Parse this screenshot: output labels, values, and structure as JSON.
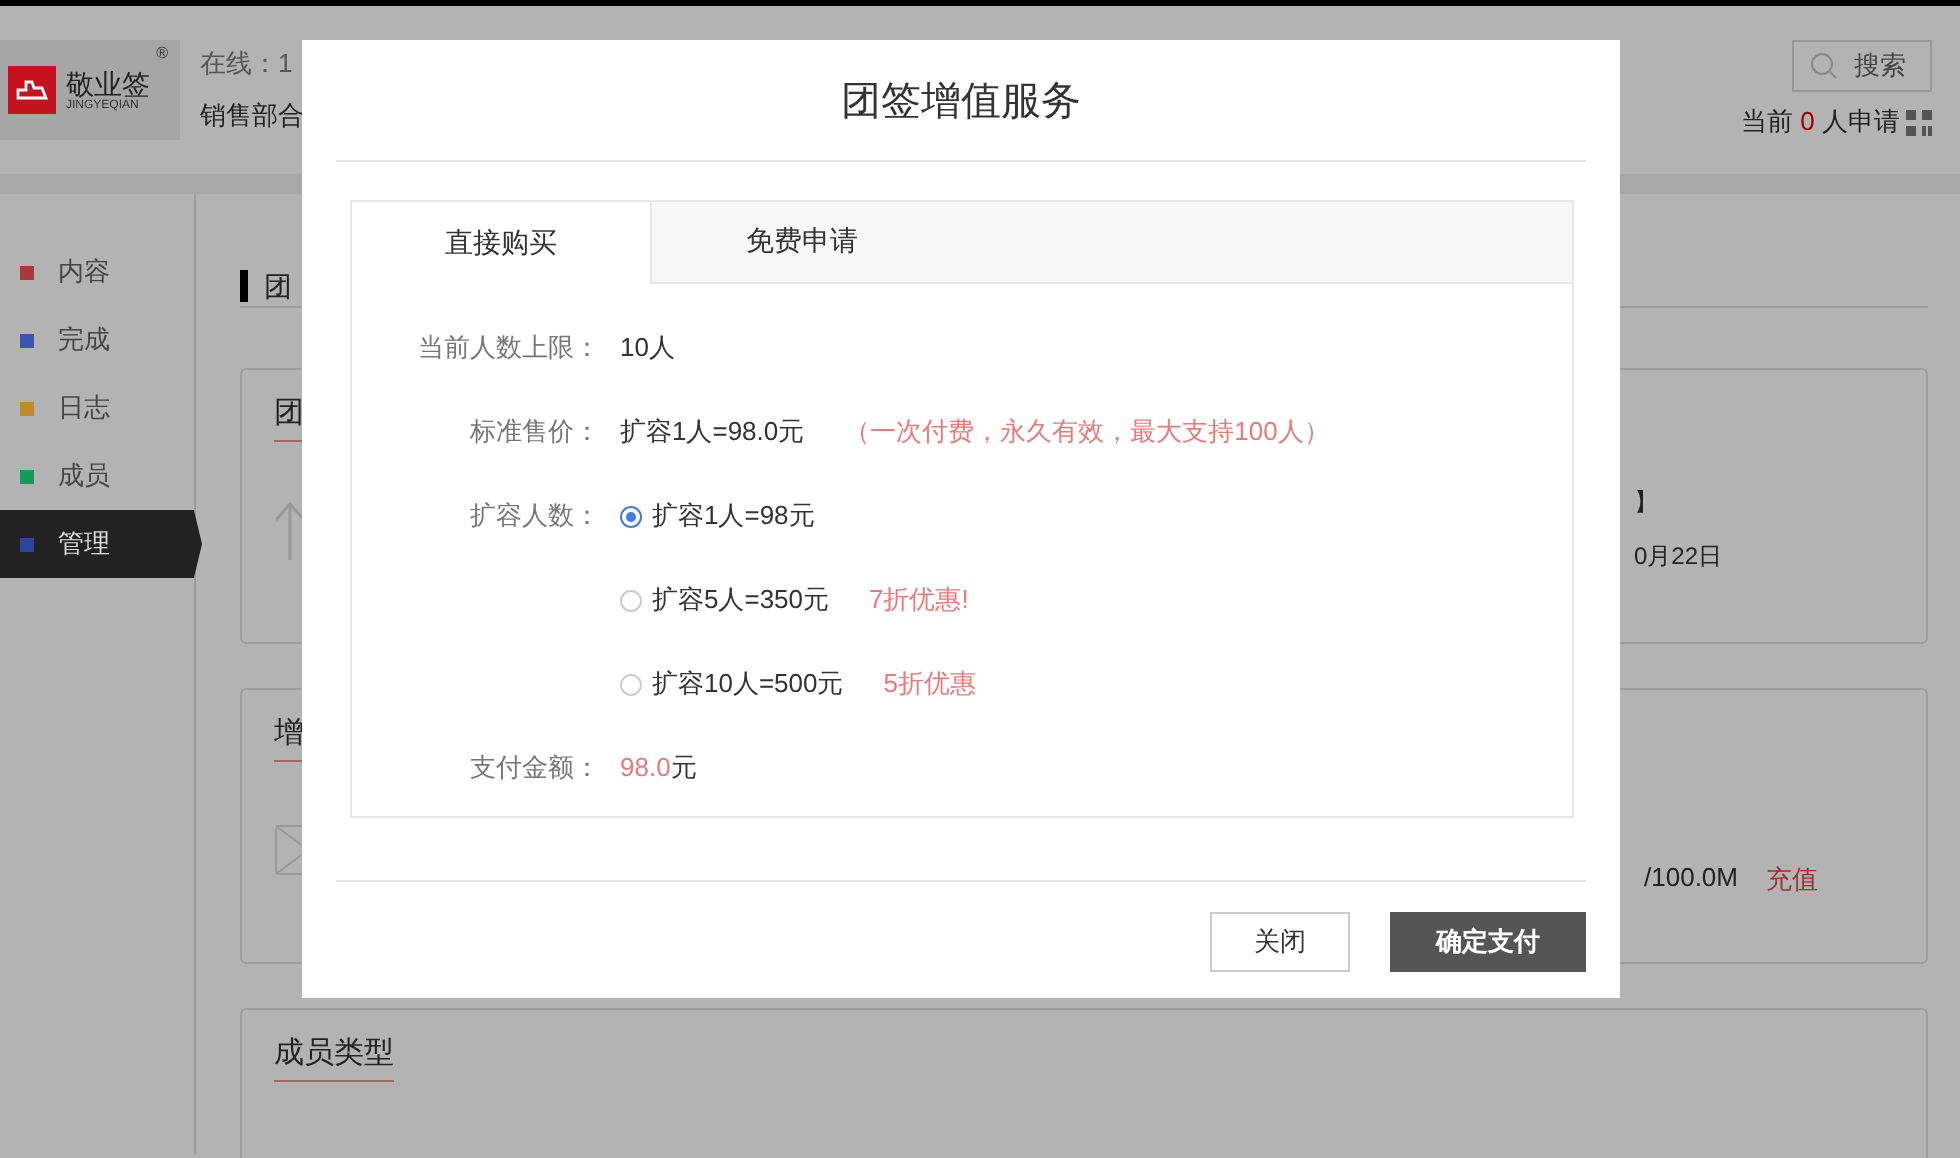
{
  "header": {
    "logo": {
      "name": "敬业签",
      "subtitle": "JINGYEQIAN",
      "mark": "®"
    },
    "online": "在线：1",
    "department": "销售部合",
    "search": {
      "placeholder": "搜索"
    },
    "applications": {
      "prefix": "当前",
      "count": "0",
      "suffix": "人申请"
    }
  },
  "sidebar": {
    "items": [
      {
        "label": "内容",
        "color": "#a83a3e",
        "selected": false
      },
      {
        "label": "完成",
        "color": "#3b55b0",
        "selected": false
      },
      {
        "label": "日志",
        "color": "#c08a2a",
        "selected": false
      },
      {
        "label": "成员",
        "color": "#149a58",
        "selected": false
      },
      {
        "label": "管理",
        "color": "#2a46a0",
        "selected": true
      }
    ]
  },
  "content": {
    "heading": "团",
    "cards": [
      {
        "kind": "info",
        "title": "团",
        "lines": [
          "】",
          "0月22日"
        ]
      },
      {
        "kind": "storage",
        "title": "增",
        "usage": "/100.0M",
        "link": "充值"
      },
      {
        "kind": "plain",
        "title": "成员类型"
      }
    ]
  },
  "dialog": {
    "title": "团签增值服务",
    "tabs": [
      {
        "label": "直接购买",
        "selected": true
      },
      {
        "label": "免费申请",
        "selected": false
      }
    ],
    "fields": [
      {
        "kind": "text",
        "label": "当前人数上限：",
        "value": "10人"
      },
      {
        "kind": "text",
        "label": "标准售价：",
        "value": "扩容1人=98.0元",
        "note": "（一次付费，永久有效，最大支持100人）"
      },
      {
        "kind": "options",
        "label": "扩容人数：",
        "options": [
          {
            "label": "扩容1人=98元",
            "selected": true
          },
          {
            "label": "扩容5人=350元",
            "note": "7折优惠!",
            "selected": false
          },
          {
            "label": "扩容10人=500元",
            "note": "5折优惠",
            "selected": false
          }
        ]
      },
      {
        "kind": "amount",
        "label": "支付金额：",
        "amount": "98.0",
        "unit": "元"
      }
    ],
    "buttons": [
      {
        "label": "关闭",
        "primary": false
      },
      {
        "label": "确定支付",
        "primary": true
      }
    ]
  }
}
